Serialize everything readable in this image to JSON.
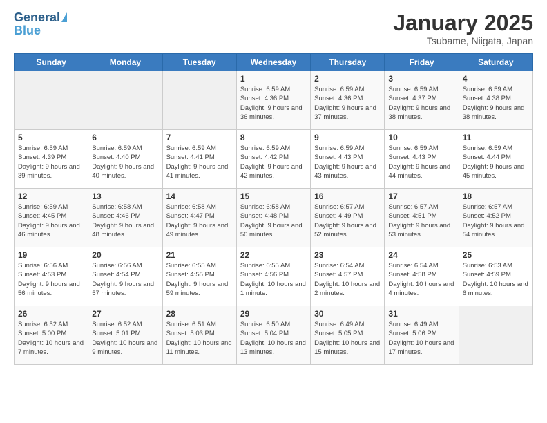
{
  "logo": {
    "general": "General",
    "blue": "Blue"
  },
  "header": {
    "month": "January 2025",
    "location": "Tsubame, Niigata, Japan"
  },
  "weekdays": [
    "Sunday",
    "Monday",
    "Tuesday",
    "Wednesday",
    "Thursday",
    "Friday",
    "Saturday"
  ],
  "weeks": [
    [
      {
        "day": "",
        "info": ""
      },
      {
        "day": "",
        "info": ""
      },
      {
        "day": "",
        "info": ""
      },
      {
        "day": "1",
        "info": "Sunrise: 6:59 AM\nSunset: 4:36 PM\nDaylight: 9 hours and 36 minutes."
      },
      {
        "day": "2",
        "info": "Sunrise: 6:59 AM\nSunset: 4:36 PM\nDaylight: 9 hours and 37 minutes."
      },
      {
        "day": "3",
        "info": "Sunrise: 6:59 AM\nSunset: 4:37 PM\nDaylight: 9 hours and 38 minutes."
      },
      {
        "day": "4",
        "info": "Sunrise: 6:59 AM\nSunset: 4:38 PM\nDaylight: 9 hours and 38 minutes."
      }
    ],
    [
      {
        "day": "5",
        "info": "Sunrise: 6:59 AM\nSunset: 4:39 PM\nDaylight: 9 hours and 39 minutes."
      },
      {
        "day": "6",
        "info": "Sunrise: 6:59 AM\nSunset: 4:40 PM\nDaylight: 9 hours and 40 minutes."
      },
      {
        "day": "7",
        "info": "Sunrise: 6:59 AM\nSunset: 4:41 PM\nDaylight: 9 hours and 41 minutes."
      },
      {
        "day": "8",
        "info": "Sunrise: 6:59 AM\nSunset: 4:42 PM\nDaylight: 9 hours and 42 minutes."
      },
      {
        "day": "9",
        "info": "Sunrise: 6:59 AM\nSunset: 4:43 PM\nDaylight: 9 hours and 43 minutes."
      },
      {
        "day": "10",
        "info": "Sunrise: 6:59 AM\nSunset: 4:43 PM\nDaylight: 9 hours and 44 minutes."
      },
      {
        "day": "11",
        "info": "Sunrise: 6:59 AM\nSunset: 4:44 PM\nDaylight: 9 hours and 45 minutes."
      }
    ],
    [
      {
        "day": "12",
        "info": "Sunrise: 6:59 AM\nSunset: 4:45 PM\nDaylight: 9 hours and 46 minutes."
      },
      {
        "day": "13",
        "info": "Sunrise: 6:58 AM\nSunset: 4:46 PM\nDaylight: 9 hours and 48 minutes."
      },
      {
        "day": "14",
        "info": "Sunrise: 6:58 AM\nSunset: 4:47 PM\nDaylight: 9 hours and 49 minutes."
      },
      {
        "day": "15",
        "info": "Sunrise: 6:58 AM\nSunset: 4:48 PM\nDaylight: 9 hours and 50 minutes."
      },
      {
        "day": "16",
        "info": "Sunrise: 6:57 AM\nSunset: 4:49 PM\nDaylight: 9 hours and 52 minutes."
      },
      {
        "day": "17",
        "info": "Sunrise: 6:57 AM\nSunset: 4:51 PM\nDaylight: 9 hours and 53 minutes."
      },
      {
        "day": "18",
        "info": "Sunrise: 6:57 AM\nSunset: 4:52 PM\nDaylight: 9 hours and 54 minutes."
      }
    ],
    [
      {
        "day": "19",
        "info": "Sunrise: 6:56 AM\nSunset: 4:53 PM\nDaylight: 9 hours and 56 minutes."
      },
      {
        "day": "20",
        "info": "Sunrise: 6:56 AM\nSunset: 4:54 PM\nDaylight: 9 hours and 57 minutes."
      },
      {
        "day": "21",
        "info": "Sunrise: 6:55 AM\nSunset: 4:55 PM\nDaylight: 9 hours and 59 minutes."
      },
      {
        "day": "22",
        "info": "Sunrise: 6:55 AM\nSunset: 4:56 PM\nDaylight: 10 hours and 1 minute."
      },
      {
        "day": "23",
        "info": "Sunrise: 6:54 AM\nSunset: 4:57 PM\nDaylight: 10 hours and 2 minutes."
      },
      {
        "day": "24",
        "info": "Sunrise: 6:54 AM\nSunset: 4:58 PM\nDaylight: 10 hours and 4 minutes."
      },
      {
        "day": "25",
        "info": "Sunrise: 6:53 AM\nSunset: 4:59 PM\nDaylight: 10 hours and 6 minutes."
      }
    ],
    [
      {
        "day": "26",
        "info": "Sunrise: 6:52 AM\nSunset: 5:00 PM\nDaylight: 10 hours and 7 minutes."
      },
      {
        "day": "27",
        "info": "Sunrise: 6:52 AM\nSunset: 5:01 PM\nDaylight: 10 hours and 9 minutes."
      },
      {
        "day": "28",
        "info": "Sunrise: 6:51 AM\nSunset: 5:03 PM\nDaylight: 10 hours and 11 minutes."
      },
      {
        "day": "29",
        "info": "Sunrise: 6:50 AM\nSunset: 5:04 PM\nDaylight: 10 hours and 13 minutes."
      },
      {
        "day": "30",
        "info": "Sunrise: 6:49 AM\nSunset: 5:05 PM\nDaylight: 10 hours and 15 minutes."
      },
      {
        "day": "31",
        "info": "Sunrise: 6:49 AM\nSunset: 5:06 PM\nDaylight: 10 hours and 17 minutes."
      },
      {
        "day": "",
        "info": ""
      }
    ]
  ]
}
